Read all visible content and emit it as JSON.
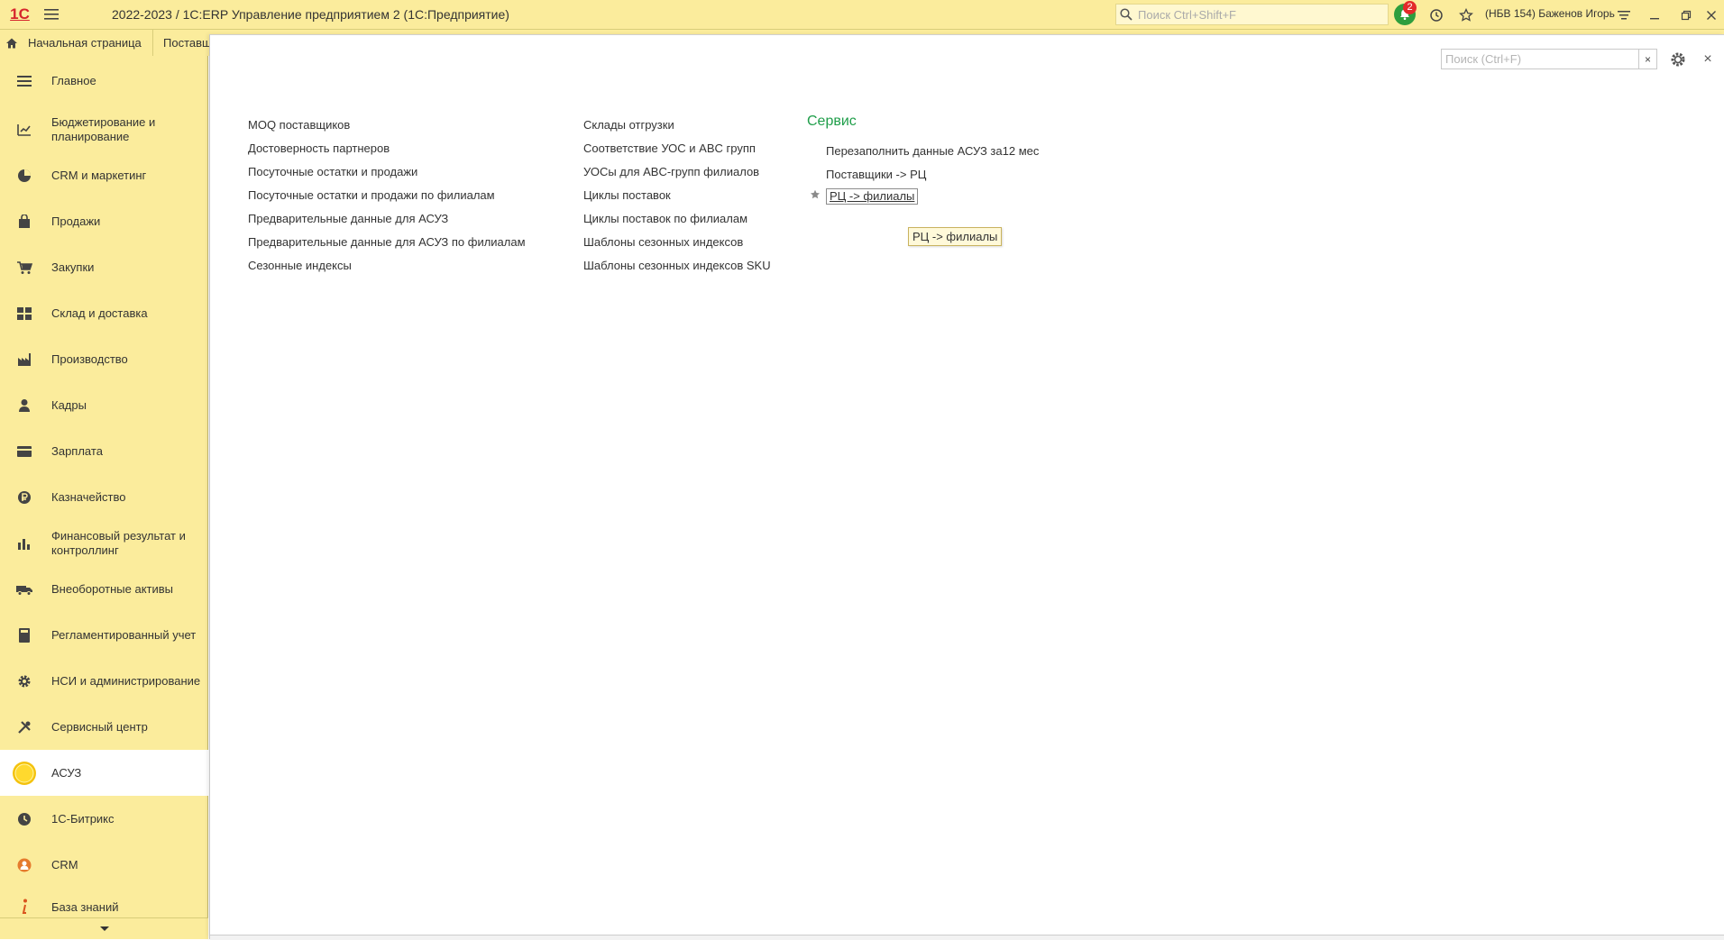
{
  "window": {
    "logo": "1С",
    "title": "2022-2023 / 1С:ERP Управление предприятием 2  (1С:Предприятие)",
    "search_placeholder": "Поиск Ctrl+Shift+F",
    "notifications_count": "2",
    "user": "(НБВ 154) Баженов Игорь"
  },
  "tabs": [
    {
      "label": "Начальная страница",
      "icon": "home-icon"
    },
    {
      "label": "Поставщ"
    }
  ],
  "sidebar": {
    "items": [
      {
        "label": "Главное",
        "icon": "list-icon"
      },
      {
        "label": "Бюджетирование и планирование",
        "icon": "budget-icon"
      },
      {
        "label": "CRM и маркетинг",
        "icon": "pie-chart-icon"
      },
      {
        "label": "Продажи",
        "icon": "bag-icon"
      },
      {
        "label": "Закупки",
        "icon": "cart-icon"
      },
      {
        "label": "Склад и доставка",
        "icon": "warehouse-icon"
      },
      {
        "label": "Производство",
        "icon": "factory-icon"
      },
      {
        "label": "Кадры",
        "icon": "person-icon"
      },
      {
        "label": "Зарплата",
        "icon": "wallet-icon"
      },
      {
        "label": "Казначейство",
        "icon": "ruble-coin-icon"
      },
      {
        "label": "Финансовый результат и контроллинг",
        "icon": "bar-chart-icon"
      },
      {
        "label": "Внеоборотные активы",
        "icon": "truck-icon"
      },
      {
        "label": "Регламентированный учет",
        "icon": "calculator-icon"
      },
      {
        "label": "НСИ и администрирование",
        "icon": "gear-icon"
      },
      {
        "label": "Сервисный центр",
        "icon": "tools-icon"
      },
      {
        "label": "АСУЗ",
        "icon": "yellow-circle-icon",
        "active": true
      },
      {
        "label": "1С-Битрикс",
        "icon": "bitrix-icon"
      },
      {
        "label": "CRM",
        "icon": "crm-person-icon"
      },
      {
        "label": "База знаний",
        "icon": "info-icon"
      }
    ]
  },
  "main": {
    "search_placeholder": "Поиск (Ctrl+F)",
    "clear_label": "×",
    "close_label": "×",
    "column1": [
      "MOQ поставщиков",
      "Достоверность партнеров",
      "Посуточные остатки и продажи",
      "Посуточные остатки и продажи по филиалам",
      "Предварительные данные для АСУЗ",
      "Предварительные данные для АСУЗ  по филиалам",
      "Сезонные индексы"
    ],
    "column2": [
      "Склады отгрузки",
      "Соответствие УОС и ABC групп",
      "УОСы для ABC-групп филиалов",
      "Циклы поставок",
      "Циклы поставок по филиалам",
      "Шаблоны сезонных индексов",
      "Шаблоны сезонных индексов SKU"
    ],
    "service": {
      "title": "Сервис",
      "items": [
        "Перезаполнить данные АСУЗ за12 мес",
        "Поставщики -> РЦ",
        "РЦ -> филиалы"
      ]
    },
    "tooltip": "РЦ -> филиалы"
  },
  "colors": {
    "panel": "#FBEC9C",
    "group_title": "#1f9e4a",
    "bell": "#2e9e3e",
    "badge": "#e32a2a"
  }
}
